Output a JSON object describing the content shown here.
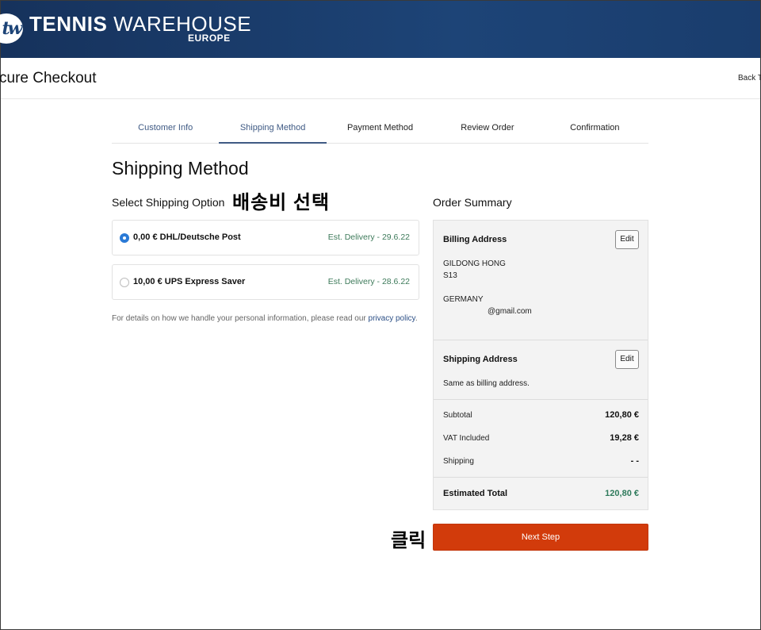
{
  "header": {
    "logo_mark": "tw",
    "brand_bold": "TENNIS",
    "brand_light": "WAREHOUSE",
    "brand_region": "EUROPE"
  },
  "title_bar": {
    "heading": "cure Checkout",
    "back_link": "Back To"
  },
  "steps": [
    {
      "label": "Customer Info",
      "state": "done"
    },
    {
      "label": "Shipping Method",
      "state": "active"
    },
    {
      "label": "Payment Method",
      "state": "pending"
    },
    {
      "label": "Review Order",
      "state": "pending"
    },
    {
      "label": "Confirmation",
      "state": "pending"
    }
  ],
  "main": {
    "title": "Shipping Method",
    "subtitle": "Select Shipping Option",
    "annotation_select": "배송비 선택",
    "options": [
      {
        "label": "0,00 € DHL/Deutsche Post",
        "delivery": "Est. Delivery - 29.6.22",
        "selected": true
      },
      {
        "label": "10,00 € UPS Express Saver",
        "delivery": "Est. Delivery - 28.6.22",
        "selected": false
      }
    ],
    "privacy_text": "For details on how we handle your personal information, please read our ",
    "privacy_link": "privacy policy",
    "privacy_end": "."
  },
  "summary": {
    "title": "Order Summary",
    "billing": {
      "heading": "Billing Address",
      "edit_label": "Edit",
      "lines": [
        "GILDONG HONG",
        "S13",
        "GERMANY",
        "@gmail.com"
      ]
    },
    "shipping": {
      "heading": "Shipping Address",
      "edit_label": "Edit",
      "text": "Same as billing address."
    },
    "rows": [
      {
        "label": "Subtotal",
        "value": "120,80 €"
      },
      {
        "label": "VAT Included",
        "value": "19,28 €"
      },
      {
        "label": "Shipping",
        "value": "- -"
      }
    ],
    "total_label": "Estimated Total",
    "total_value": "120,80 €"
  },
  "annotation_click": "클릭",
  "next_button": "Next Step",
  "colors": {
    "header_bg": "#1d4477",
    "accent_blue": "#3f5a84",
    "next_button": "#d23b0b",
    "delivery_green": "#3d7a5a",
    "total_green": "#2e7a5b"
  }
}
